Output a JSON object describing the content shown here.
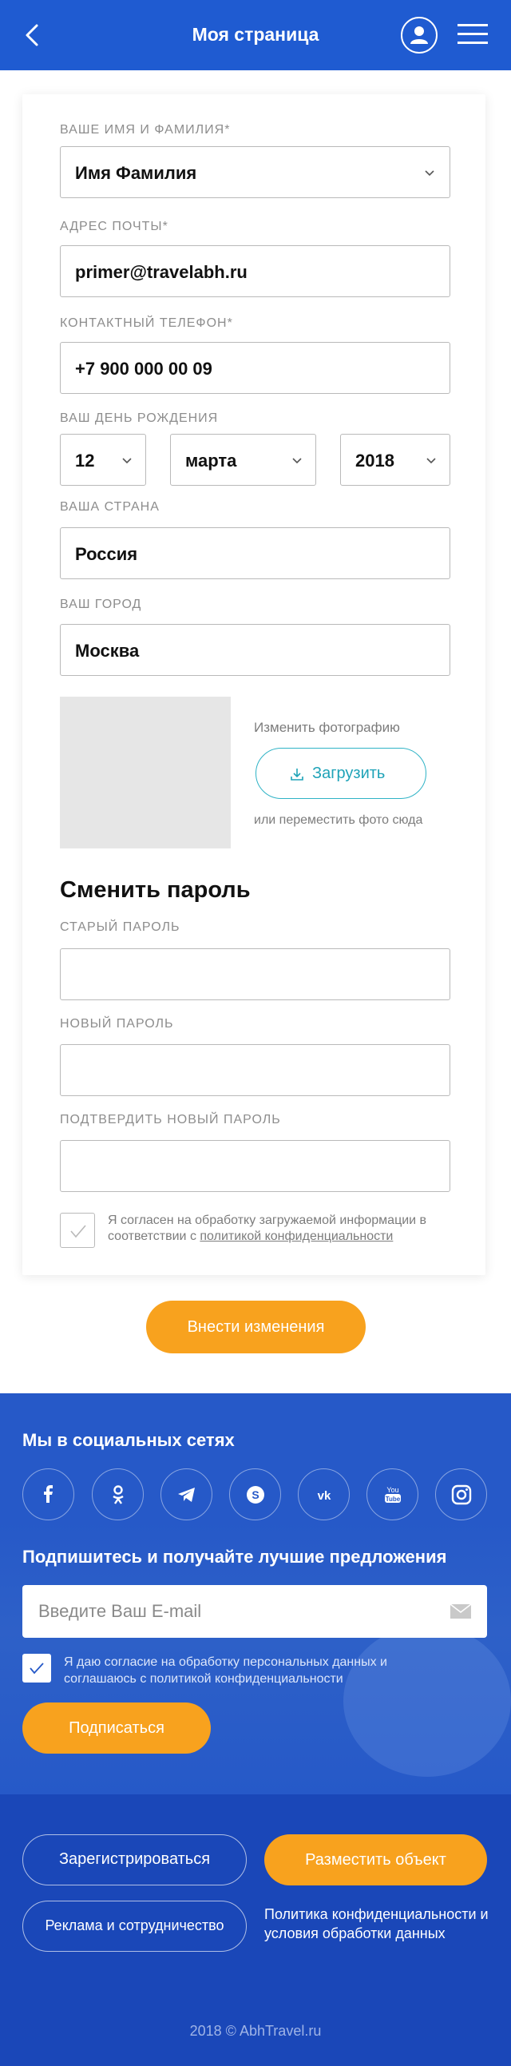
{
  "header": {
    "title": "Моя страница",
    "back_icon": "chevron-left-icon",
    "user_icon": "user-icon",
    "menu_icon": "hamburger-menu-icon"
  },
  "form": {
    "name_label": "ВАШЕ ИМЯ И ФАМИЛИЯ*",
    "name_value": "Имя Фамилия",
    "email_label": "АДРЕС ПОЧТЫ*",
    "email_value": "primer@travelabh.ru",
    "phone_label": "КОНТАКТНЫЙ ТЕЛЕФОН*",
    "phone_value": "+7 900 000 00 09",
    "birthday_label": "ВАШ ДЕНЬ РОЖДЕНИЯ",
    "birthday_day": "12",
    "birthday_month": "марта",
    "birthday_year": "2018",
    "country_label": "ВАША СТРАНА",
    "country_value": "Россия",
    "city_label": "ВАШ ГОРОД",
    "city_value": "Москва"
  },
  "photo": {
    "change_label": "Изменить фотографию",
    "upload_label": "Загрузить",
    "drop_hint": "или переместить фото сюда"
  },
  "password": {
    "title": "Сменить пароль",
    "old_label": "СТАРЫЙ ПАРОЛЬ",
    "new_label": "НОВЫЙ ПАРОЛЬ",
    "confirm_label": "ПОДТВЕРДИТЬ НОВЫЙ ПАРОЛЬ"
  },
  "consent": {
    "text": "Я согласен на обработку загружаемой информации в соответствии с ",
    "link": "политикой конфиденциальности"
  },
  "submit_label": "Внести изменения",
  "footer": {
    "social_title": "Мы в социальных сетях",
    "social_icons": [
      "facebook-icon",
      "odnoklassniki-icon",
      "telegram-icon",
      "skype-icon",
      "vk-icon",
      "youtube-icon",
      "instagram-icon"
    ],
    "subscribe_title": "Подпишитесь и получайте лучшие предложения",
    "email_placeholder": "Введите Ваш E-mail",
    "consent_text": "Я даю согласие на обработку персональных данных и соглашаюсь с политикой конфиденциальности",
    "subscribe_label": "Подписаться",
    "register_label": "Зарегистрироваться",
    "place_label": "Разместить объект",
    "ads_label": "Реклама и сотрудничество",
    "policy_label": "Политика конфиденциальности и условия обработки данных",
    "copyright": "2018 © AbhTravel.ru"
  },
  "colors": {
    "header_blue": "#1f5bd1",
    "footer_blue": "#2659c8",
    "bottom_blue": "#1a47b8",
    "accent_orange": "#f8a21e",
    "upload_teal": "#1fa3b8"
  }
}
